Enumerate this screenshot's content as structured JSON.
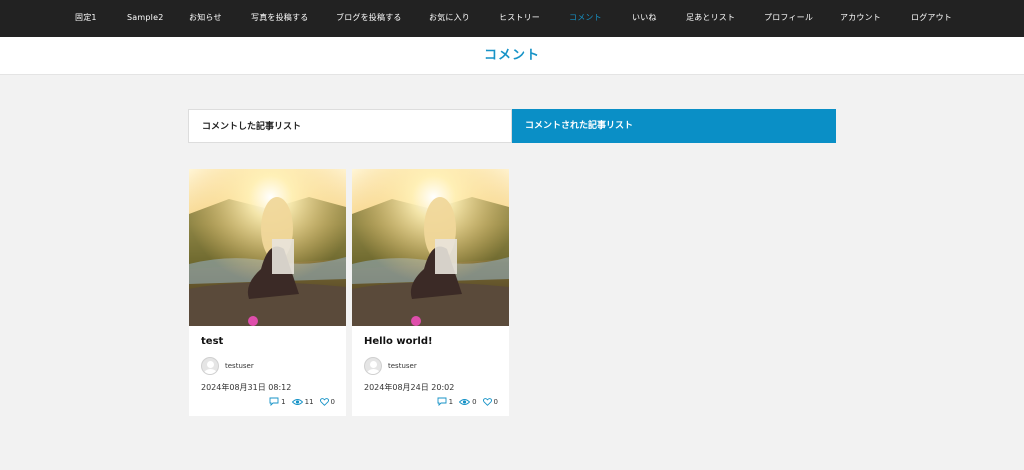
{
  "nav": {
    "items": [
      {
        "label": "固定1",
        "active": false
      },
      {
        "label": "Sample2",
        "active": false
      },
      {
        "label": "お知らせ",
        "active": false
      },
      {
        "label": "写真を投稿する",
        "active": false
      },
      {
        "label": "ブログを投稿する",
        "active": false
      },
      {
        "label": "お気に入り",
        "active": false
      },
      {
        "label": "ヒストリー",
        "active": false
      },
      {
        "label": "コメント",
        "active": true
      },
      {
        "label": "いいね",
        "active": false
      },
      {
        "label": "足あとリスト",
        "active": false
      },
      {
        "label": "プロフィール",
        "active": false
      },
      {
        "label": "アカウント",
        "active": false
      },
      {
        "label": "ログアウト",
        "active": false
      }
    ]
  },
  "page": {
    "title": "コメント"
  },
  "tabs": [
    {
      "label": "コメントした記事リスト",
      "active": false
    },
    {
      "label": "コメントされた記事リスト",
      "active": true
    }
  ],
  "posts": [
    {
      "title": "test",
      "author": "testuser",
      "date": "2024年08月31日 08:12",
      "comments": "1",
      "views": "11",
      "likes": "0",
      "thumbnail": "woman-sitting-sunset-photo"
    },
    {
      "title": "Hello world!",
      "author": "testuser",
      "date": "2024年08月24日 20:02",
      "comments": "1",
      "views": "0",
      "likes": "0",
      "thumbnail": "woman-sitting-sunset-photo"
    }
  ],
  "colors": {
    "nav_bg": "#222222",
    "accent": "#1793c7",
    "active_tab": "#0a8fc6",
    "page_bg": "#f2f2f2"
  }
}
